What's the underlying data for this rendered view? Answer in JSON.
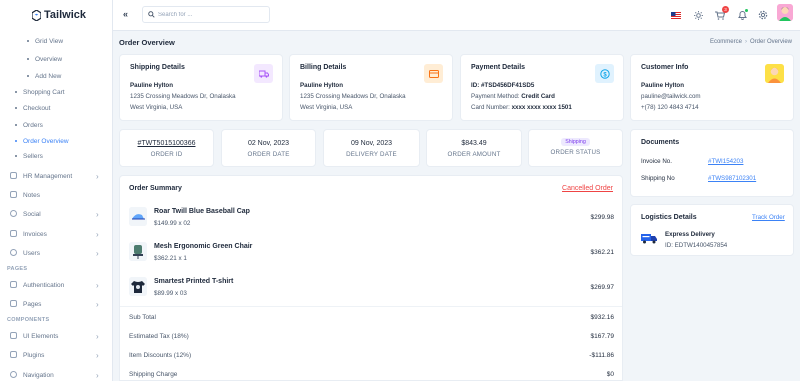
{
  "brand": {
    "name": "Tailwick"
  },
  "sidebar": {
    "sub_top": [
      "Grid View",
      "Overview",
      "Add New"
    ],
    "items": [
      {
        "label": "Shopping Cart",
        "type": "sub"
      },
      {
        "label": "Checkout",
        "type": "sub"
      },
      {
        "label": "Orders",
        "type": "sub"
      },
      {
        "label": "Order Overview",
        "type": "sub",
        "active": true
      },
      {
        "label": "Sellers",
        "type": "sub"
      },
      {
        "label": "HR Management",
        "type": "group"
      },
      {
        "label": "Notes",
        "type": "plain"
      },
      {
        "label": "Social",
        "type": "group"
      },
      {
        "label": "Invoices",
        "type": "group"
      },
      {
        "label": "Users",
        "type": "group"
      }
    ],
    "section_pages": "PAGES",
    "pages": [
      {
        "label": "Authentication"
      },
      {
        "label": "Pages"
      }
    ],
    "section_components": "COMPONENTS",
    "components": [
      {
        "label": "UI Elements"
      },
      {
        "label": "Plugins"
      },
      {
        "label": "Navigation"
      }
    ]
  },
  "topbar": {
    "search_placeholder": "Search for ...",
    "cart_count": "3",
    "colors": {
      "accent": "#3b82f6",
      "badge": "#ef4444",
      "online": "#22c55e"
    },
    "icons": [
      "us-flag-icon",
      "sun-icon",
      "cart-icon",
      "bell-icon",
      "gear-icon",
      "avatar"
    ]
  },
  "page": {
    "title": "Order Overview",
    "breadcrumb": [
      "Ecommerce",
      "Order Overview"
    ]
  },
  "shipping": {
    "title": "Shipping Details",
    "name": "Pauline Hylton",
    "address": "1235 Crossing Meadows Dr, Onalaska",
    "region": "West Virginia, USA",
    "icon": "truck-icon"
  },
  "billing": {
    "title": "Billing Details",
    "name": "Pauline Hylton",
    "address": "1235 Crossing Meadows Dr, Onalaska",
    "region": "West Virginia, USA",
    "icon": "card-icon"
  },
  "payment": {
    "title": "Payment Details",
    "id": "ID: #TSD456DF41SD5",
    "method_label": "Payment Method: ",
    "method_value": "Credit Card",
    "card_label": "Card Number: ",
    "card_value": "xxxx xxxx xxxx 1501",
    "icon": "dollar-icon"
  },
  "customer": {
    "title": "Customer Info",
    "name": "Pauline Hylton",
    "email": "pauline@tailwick.com",
    "phone": "+(78) 120 4843 4714"
  },
  "stats": [
    {
      "value": "#TWT5015100366",
      "label": "ORDER ID"
    },
    {
      "value": "02 Nov, 2023",
      "label": "ORDER DATE"
    },
    {
      "value": "09 Nov, 2023",
      "label": "DELIVERY DATE"
    },
    {
      "value": "$843.49",
      "label": "ORDER AMOUNT"
    },
    {
      "value": "Shipping",
      "label": "ORDER STATUS"
    }
  ],
  "summary": {
    "title": "Order Summary",
    "status_link": "Cancelled Order",
    "items": [
      {
        "name": "Roar Twill Blue Baseball Cap",
        "qty": "$149.99 x 02",
        "price": "$299.98"
      },
      {
        "name": "Mesh Ergonomic Green Chair",
        "qty": "$362.21 x 1",
        "price": "$362.21"
      },
      {
        "name": "Smartest Printed T-shirt",
        "qty": "$89.99 x 03",
        "price": "$269.97"
      }
    ],
    "totals": [
      {
        "label": "Sub Total",
        "value": "$932.16"
      },
      {
        "label": "Estimated Tax (18%)",
        "value": "$167.79"
      },
      {
        "label": "Item Discounts (12%)",
        "value": "-$111.86"
      },
      {
        "label": "Shipping Charge",
        "value": "$0"
      }
    ]
  },
  "documents": {
    "title": "Documents",
    "invoice_label": "Invoice No.",
    "invoice_value": "#TWI154203",
    "shipping_label": "Shipping No",
    "shipping_value": "#TWS987102301"
  },
  "logistics": {
    "title": "Logistics Details",
    "track_link": "Track Order",
    "service": "Express Delivery",
    "id": "ID: EDTW1400457854"
  }
}
